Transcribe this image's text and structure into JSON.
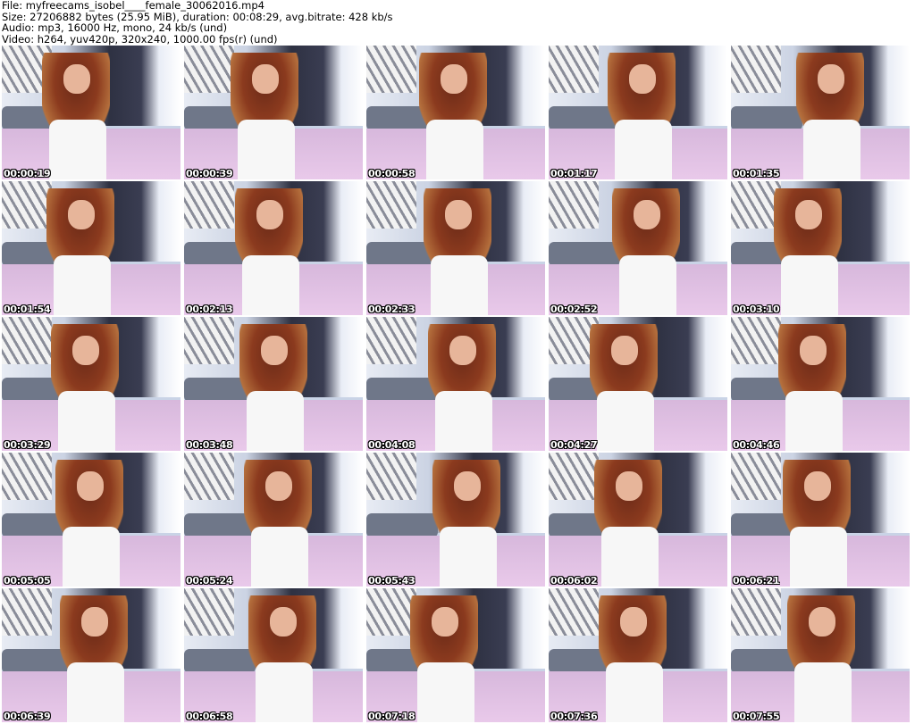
{
  "header": {
    "file": "File: myfreecams_isobel____female_30062016.mp4",
    "size": "Size: 27206882 bytes (25.95 MiB), duration: 00:08:29, avg.bitrate: 428 kb/s",
    "audio": "Audio: mp3, 16000 Hz, mono, 24 kb/s (und)",
    "video": "Video: h264, yuv420p, 320x240, 1000.00 fps(r) (und)"
  },
  "thumbnails": [
    "00:00:19",
    "00:00:39",
    "00:00:58",
    "00:01:17",
    "00:01:35",
    "00:01:54",
    "00:02:13",
    "00:02:33",
    "00:02:52",
    "00:03:10",
    "00:03:29",
    "00:03:48",
    "00:04:08",
    "00:04:27",
    "00:04:46",
    "00:05:05",
    "00:05:24",
    "00:05:43",
    "00:06:02",
    "00:06:21",
    "00:06:39",
    "00:06:58",
    "00:07:18",
    "00:07:36",
    "00:07:55"
  ]
}
